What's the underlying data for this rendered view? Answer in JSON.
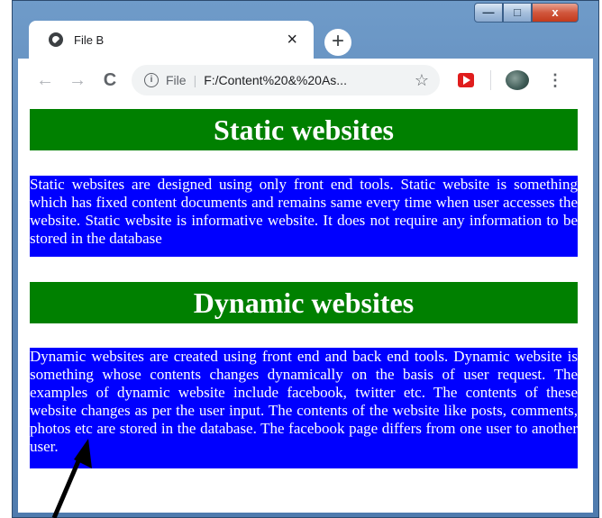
{
  "browser": {
    "tab_title": "File B",
    "tab_close": "×",
    "new_tab": "+",
    "address_scheme": "File",
    "address_url": "F:/Content%20&%20As...",
    "back_icon": "←",
    "forward_icon": "→",
    "reload_icon": "C",
    "star_icon": "☆",
    "menu_icon": "⋮",
    "window_controls": {
      "minimize": "—",
      "maximize": "□",
      "close": "x"
    }
  },
  "page": {
    "heading1": "Static websites",
    "para1": "Static websites are designed using only front end tools. Static website is something which has fixed content documents and remains same every time when user accesses the website. Static website is informative website. It does not require any information to be stored in the database",
    "heading2": "Dynamic websites",
    "para2": "Dynamic websites are created using front end and back end tools. Dynamic website is something whose contents changes dynamically on the basis of user request. The examples of dynamic website include facebook, twitter etc. The contents of these website changes as per the user input. The contents of the website like posts, comments, photos etc are stored in the database. The facebook page differs from one user to another user."
  },
  "colors": {
    "heading_bg": "#008000",
    "para_bg": "#0000ff",
    "text": "#ffffff"
  }
}
